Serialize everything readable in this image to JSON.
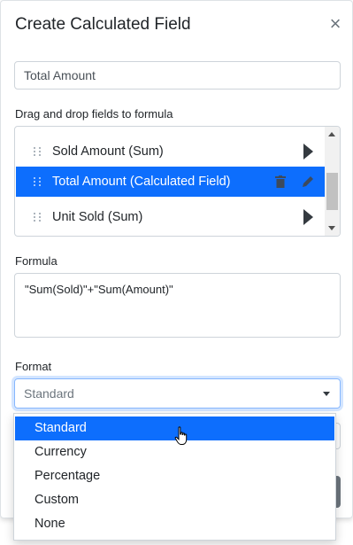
{
  "dialog": {
    "title": "Create Calculated Field",
    "close_icon": "close-icon",
    "close_glyph": "×"
  },
  "name_input": {
    "value": "Total Amount"
  },
  "fields_section": {
    "label": "Drag and drop fields to formula",
    "items": [
      {
        "label": "Sold Amount (Sum)",
        "selected": false,
        "action_icon": "chevron-right-icon"
      },
      {
        "label": "Total Amount (Calculated Field)",
        "selected": true,
        "action_icons": [
          "trash-icon",
          "edit-icon"
        ]
      },
      {
        "label": "Unit Sold (Sum)",
        "selected": false,
        "action_icon": "chevron-right-icon"
      }
    ]
  },
  "formula_section": {
    "label": "Formula",
    "value": "\"Sum(Sold)\"+\"Sum(Amount)\""
  },
  "format_section": {
    "label": "Format",
    "selected": "Standard",
    "options": [
      "Standard",
      "Currency",
      "Percentage",
      "Custom",
      "None"
    ],
    "highlighted_option": "Standard"
  },
  "colors": {
    "accent": "#0d6efd",
    "focus_border": "#86b7fe",
    "text": "#212529",
    "muted": "#6c757d"
  }
}
